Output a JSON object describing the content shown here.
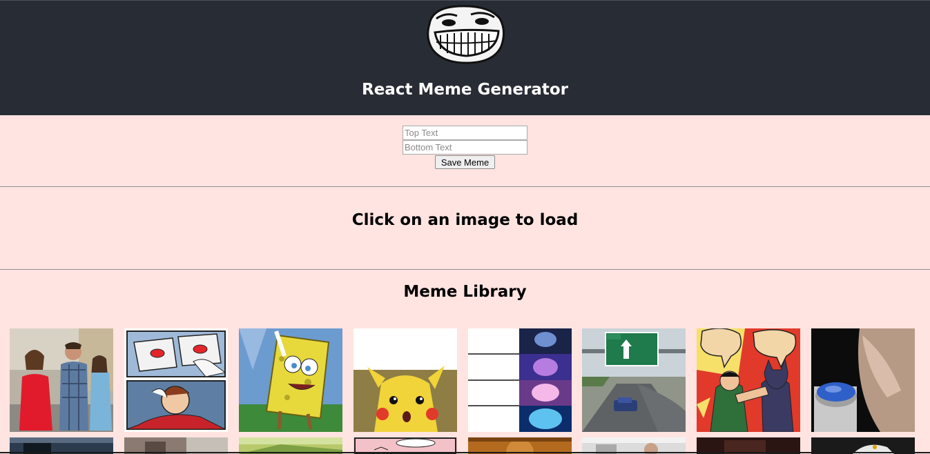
{
  "header": {
    "title": "React Meme Generator",
    "logo_icon": "troll-face-icon",
    "background": "#282c34"
  },
  "form": {
    "top_placeholder": "Top Text",
    "bottom_placeholder": "Bottom Text",
    "save_label": "Save Meme"
  },
  "preview": {
    "prompt": "Click on an image to load"
  },
  "library": {
    "title": "Meme Library",
    "items": [
      "distracted-boyfriend-meme",
      "two-buttons-meme",
      "mocking-spongebob-meme",
      "surprised-pikachu-meme",
      "expanding-brain-meme",
      "left-exit-12-off-ramp-meme",
      "batman-slapping-robin-meme",
      "blank-nut-button-meme"
    ]
  },
  "colors": {
    "page_background": "#ffe4e1",
    "header_background": "#282c34",
    "title_text": "#ffffff"
  }
}
